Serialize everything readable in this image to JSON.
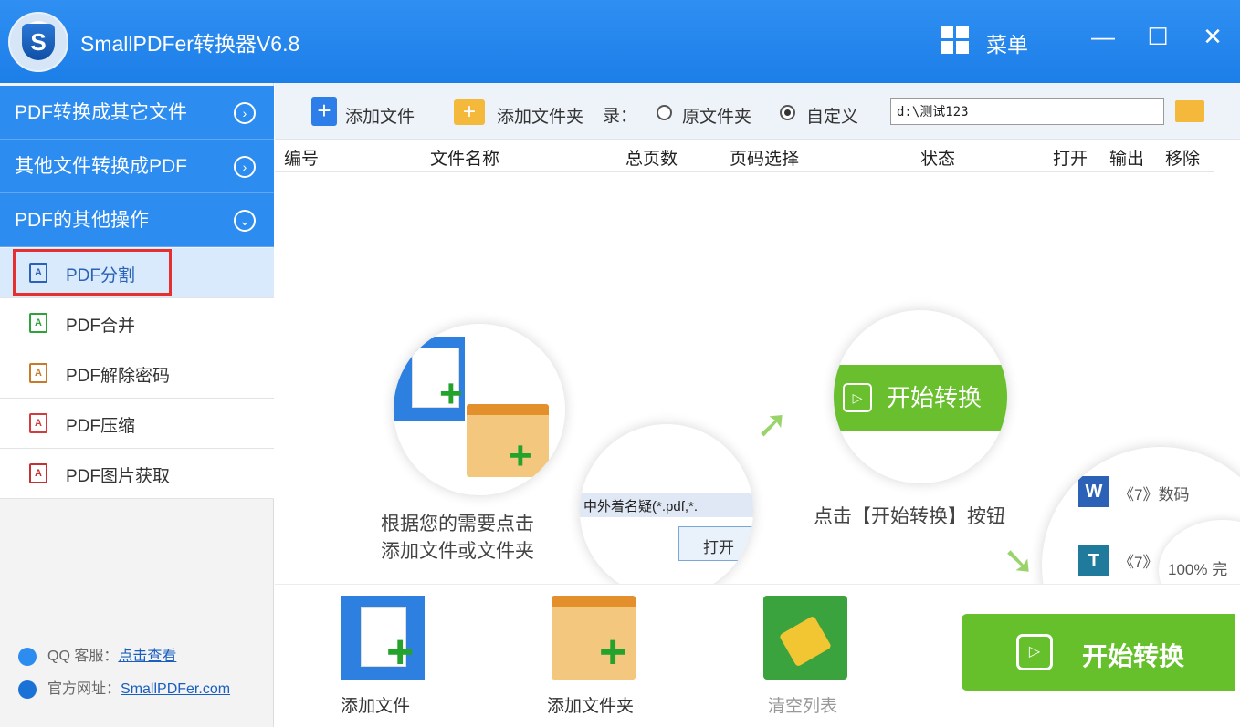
{
  "app": {
    "title": "SmallPDFer转换器V6.8",
    "menu_label": "菜单",
    "minimize": "—",
    "maximize": "☐",
    "close": "✕"
  },
  "sidebar": {
    "categories": [
      {
        "label": "PDF转换成其它文件",
        "chevron": "›"
      },
      {
        "label": "其他文件转换成PDF",
        "chevron": "›"
      },
      {
        "label": "PDF的其他操作",
        "chevron": "⌄"
      }
    ],
    "items": [
      {
        "label": "PDF分割",
        "color": "#2a62b8"
      },
      {
        "label": "PDF合并",
        "color": "#2fa33a"
      },
      {
        "label": "PDF解除密码",
        "color": "#c87a2a"
      },
      {
        "label": "PDF压缩",
        "color": "#d23c3c"
      },
      {
        "label": "PDF图片获取",
        "color": "#c23232"
      }
    ],
    "support": {
      "qq_label": "QQ 客服：",
      "qq_link": "点击查看",
      "site_label": "官方网址：",
      "site_link": "SmallPDFer.com"
    }
  },
  "toolbar": {
    "add_file": "添加文件",
    "add_folder": "添加文件夹",
    "dir_label": "录：",
    "radio_original": "原文件夹",
    "radio_custom": "自定义",
    "selected": "自定义",
    "path_value": "d:\\测试123"
  },
  "table": {
    "columns": [
      "编号",
      "文件名称",
      "总页数",
      "页码选择",
      "状态",
      "打开",
      "输出",
      "移除"
    ]
  },
  "guide": {
    "step1_line1": "根据您的需要点击",
    "step1_line2": "添加文件或文件夹",
    "dialog_file": "中外着名疑",
    "dialog_filter": "(*.pdf,*.",
    "dialog_open": "打开",
    "start_pill": "开始转换",
    "step2_text": "点击【开始转换】按钮",
    "result_1": "《7》数码",
    "result_2": "《7》",
    "progress": "100% 完"
  },
  "bottom": {
    "add_file": "添加文件",
    "add_folder": "添加文件夹",
    "clear_list": "清空列表",
    "start": "开始转换"
  },
  "colors": {
    "titlebar": "#1c7ee8",
    "sidebar_category": "#2d8cf0",
    "accent_green": "#66c02b",
    "highlight_red": "#e63030"
  }
}
